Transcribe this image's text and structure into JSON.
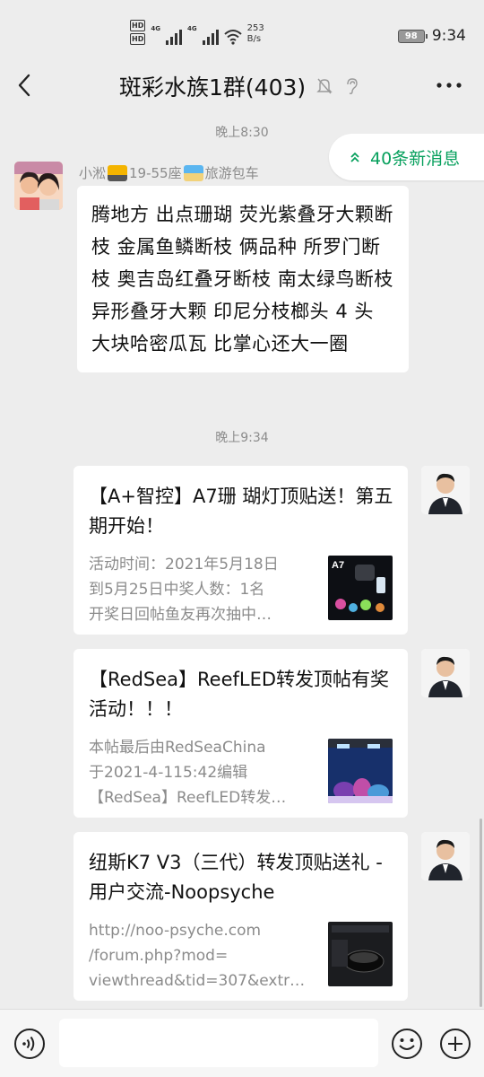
{
  "status_bar": {
    "hd1": "HD",
    "hd2": "HD",
    "net1": "4G",
    "net2": "4G",
    "speed_value": "253",
    "speed_unit": "B/s",
    "battery": "98",
    "time": "9:34"
  },
  "header": {
    "title": "斑彩水族1群(403)"
  },
  "new_messages": {
    "label": "40条新消息"
  },
  "messages": [
    {
      "timestamp": "晚上8:30",
      "sender_name_a": "小淞",
      "sender_name_b": "19-55座",
      "sender_name_c": "旅游包车",
      "text": "腾地方 出点珊瑚 荧光紫叠牙大颗断枝 金属鱼鳞断枝 俩品种 所罗门断枝 奥吉岛红叠牙断枝 南太绿鸟断枝 异形叠牙大颗 印尼分枝榔头 4 头 大块哈密瓜瓦 比掌心还大一圈"
    }
  ],
  "timestamp2": "晚上9:34",
  "cards": [
    {
      "title": "【A+智控】A7珊 瑚灯顶贴送！第五期开始！",
      "desc_lines": [
        "活动时间：2021年5月18日",
        "到5月25日中奖人数：1名",
        "开奖日回帖鱼友再次抽中…"
      ],
      "thumb_label": "A7"
    },
    {
      "title": "【RedSea】ReefLED转发顶帖有奖活动！！！",
      "desc_lines": [
        "本帖最后由RedSeaChina",
        "于2021-4-115:42编辑",
        "【RedSea】ReefLED转发…"
      ]
    },
    {
      "title": "纽斯K7 V3（三代）转发顶贴送礼 - 用户交流-Noopsyche",
      "desc_lines": [
        "http://noo-psyche.com",
        "/forum.php?mod=",
        "viewthread&tid=307&extr…"
      ]
    }
  ],
  "input": {
    "placeholder": ""
  },
  "colors": {
    "background": "#ededed",
    "accent_green": "#07a05d",
    "secondary_text": "#8b8b8b"
  }
}
